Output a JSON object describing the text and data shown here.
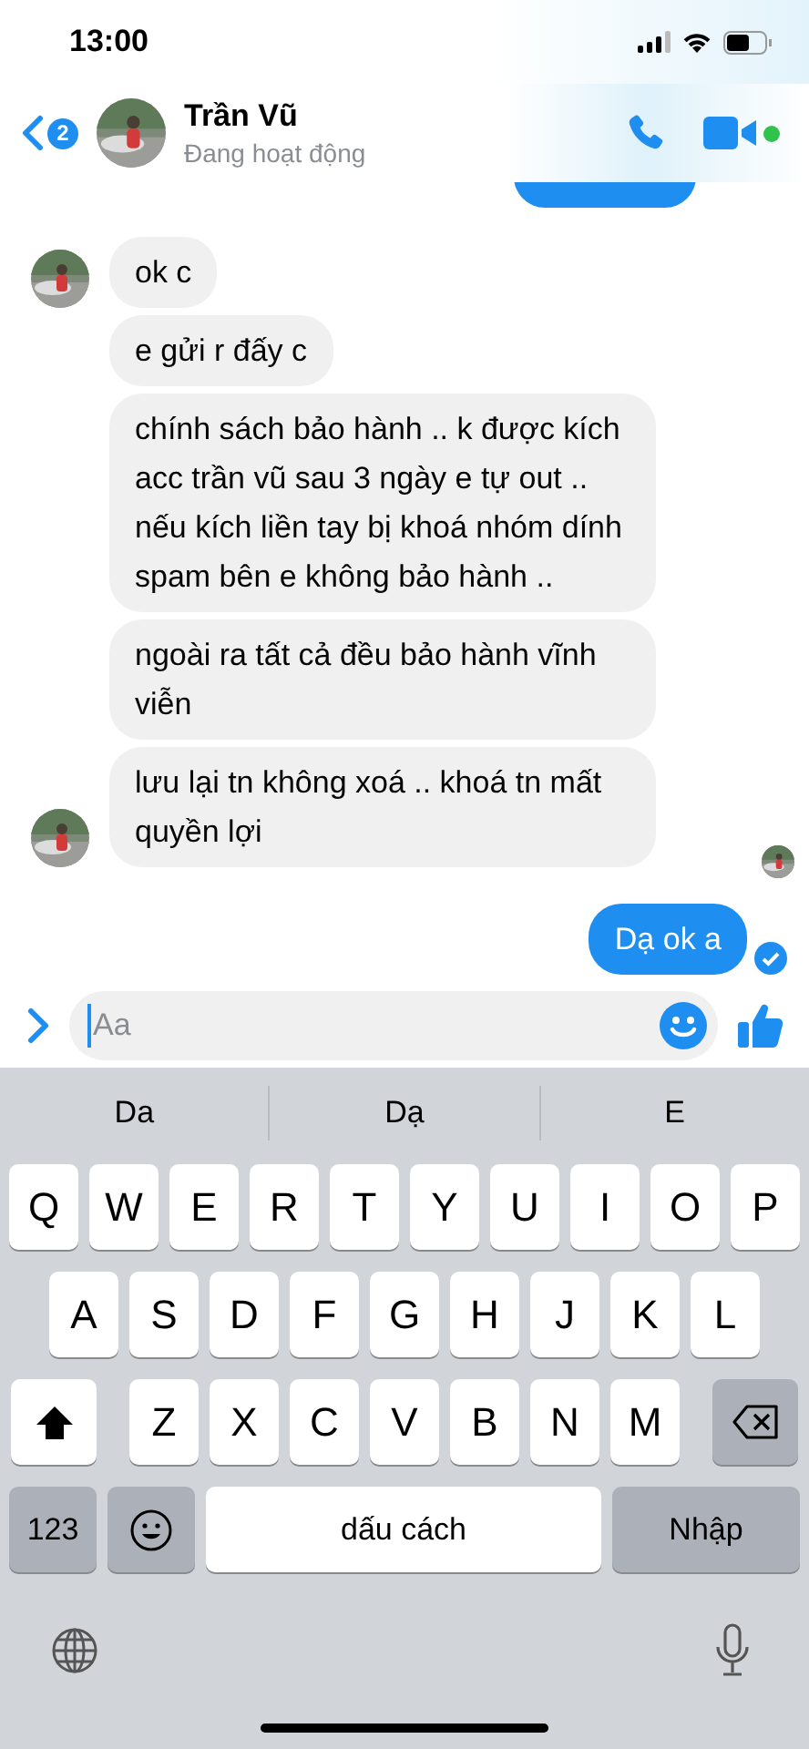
{
  "status_bar": {
    "time": "13:00"
  },
  "header": {
    "back_badge": "2",
    "name": "Trần Vũ",
    "status": "Đang hoạt động",
    "online": true
  },
  "messages": [
    {
      "kind": "cut"
    },
    {
      "kind": "incoming",
      "text": "ok c",
      "avatar": true
    },
    {
      "kind": "incoming",
      "text": "e gửi r đấy c",
      "avatar": false
    },
    {
      "kind": "incoming",
      "text": "chính sách bảo hành .. k được kích acc trần vũ sau 3 ngày e tự out .. nếu kích liền tay bị khoá nhóm dính spam bên e không bảo hành ..",
      "avatar": false
    },
    {
      "kind": "incoming",
      "text": "ngoài ra tất cả đều bảo hành vĩnh viễn",
      "avatar": false
    },
    {
      "kind": "incoming",
      "text": "lưu lại tn không xoá .. khoá tn mất quyền lợi",
      "avatar": true
    },
    {
      "kind": "outgoing",
      "text": "Dạ ok a",
      "seen": true
    }
  ],
  "composer": {
    "placeholder": "Aa"
  },
  "keyboard": {
    "suggestions": [
      "Da",
      "Dạ",
      "E"
    ],
    "letter_rows": [
      [
        "Q",
        "W",
        "E",
        "R",
        "T",
        "Y",
        "U",
        "I",
        "O",
        "P"
      ],
      [
        "A",
        "S",
        "D",
        "F",
        "G",
        "H",
        "J",
        "K",
        "L"
      ],
      [
        "Z",
        "X",
        "C",
        "V",
        "B",
        "N",
        "M"
      ]
    ],
    "numbers_key": "123",
    "space_key": "dấu cách",
    "return_key": "Nhập"
  }
}
